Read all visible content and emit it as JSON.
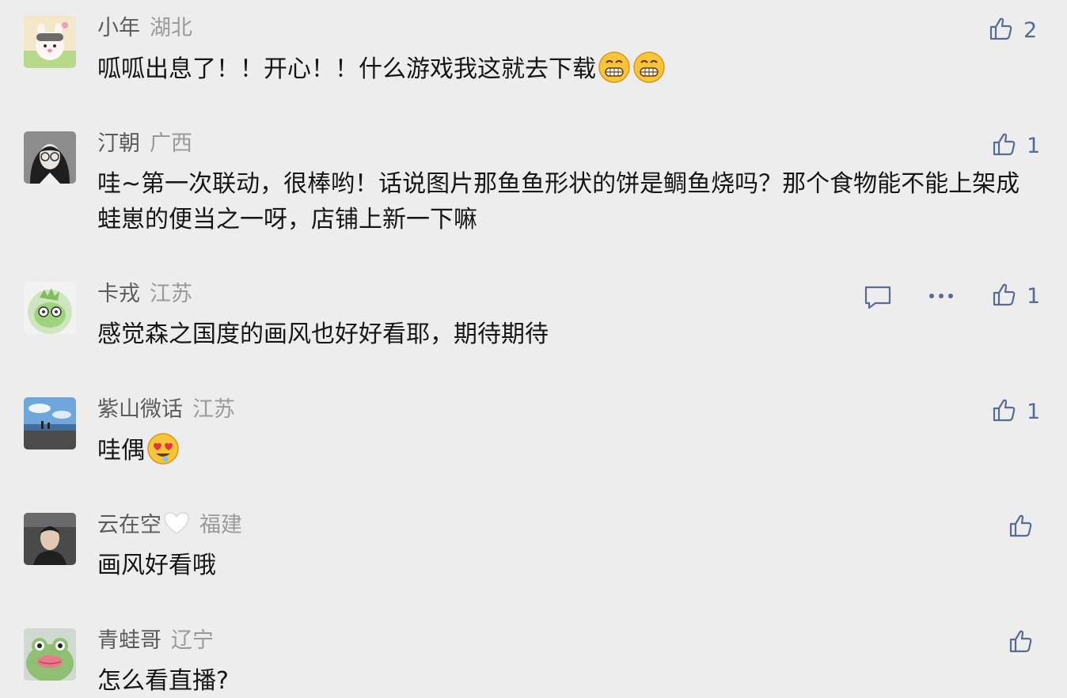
{
  "comments": [
    {
      "nickname": "小年",
      "region": "湖北",
      "text": "呱呱出息了！！开心！！什么游戏我这就去下载",
      "emoji": [
        "grinning-face-icon",
        "grinning-face-icon"
      ],
      "likes": "2"
    },
    {
      "nickname": "汀朝",
      "region": "广西",
      "text": "哇~第一次联动，很棒哟！话说图片那鱼鱼形状的饼是鲷鱼烧吗？那个食物能不能上架成蛙崽的便当之一呀，店铺上新一下嘛",
      "likes": "1"
    },
    {
      "nickname": "卡戎",
      "region": "江苏",
      "text": "感觉森之国度的画风也好好看耶，期待期待",
      "likes": "1",
      "actions": [
        "reply-icon",
        "more-icon"
      ]
    },
    {
      "nickname": "紫山微话",
      "region": "江苏",
      "text": "哇偶",
      "emoji": [
        "heart-eyes-drool-icon"
      ],
      "likes": "1"
    },
    {
      "nickname": "云在空",
      "region": "福建",
      "text": "画风好看哦",
      "nickname_emoji": "white-heart-icon",
      "likes": ""
    },
    {
      "nickname": "青蛙哥",
      "region": "辽宁",
      "text": "怎么看直播?",
      "likes": ""
    }
  ],
  "colors": {
    "background": "#ededed",
    "nickname": "#5c5c5c",
    "region": "#9a9a9a",
    "text": "#161616",
    "accent": "#576b95"
  }
}
